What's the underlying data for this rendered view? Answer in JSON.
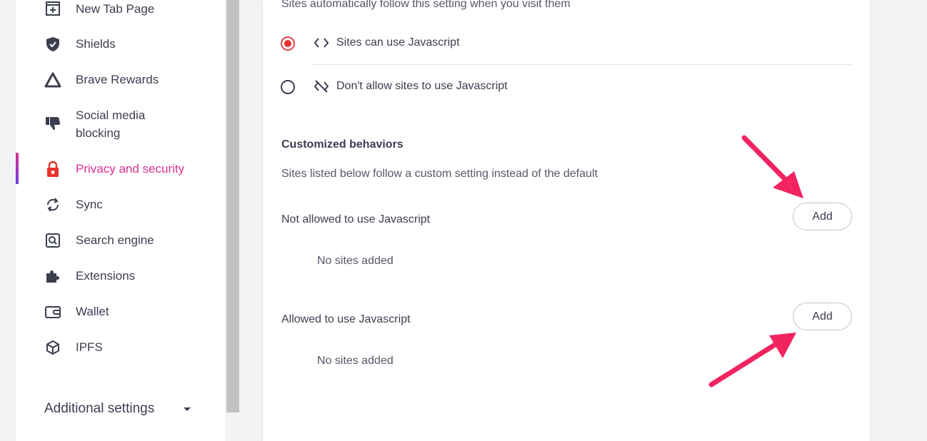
{
  "sidebar": {
    "items": [
      {
        "label": "New Tab Page",
        "icon": "new-tab-icon"
      },
      {
        "label": "Shields",
        "icon": "shield-icon"
      },
      {
        "label": "Brave Rewards",
        "icon": "rewards-triangle-icon"
      },
      {
        "label": "Social media",
        "label2": "blocking",
        "icon": "thumbs-down-icon"
      },
      {
        "label": "Privacy and security",
        "icon": "lock-icon",
        "active": true
      },
      {
        "label": "Sync",
        "icon": "sync-icon"
      },
      {
        "label": "Search engine",
        "icon": "search-engine-icon"
      },
      {
        "label": "Extensions",
        "icon": "puzzle-icon"
      },
      {
        "label": "Wallet",
        "icon": "wallet-icon"
      },
      {
        "label": "IPFS",
        "icon": "cube-icon"
      }
    ],
    "additional_settings": "Additional settings"
  },
  "main": {
    "default_description": "Sites automatically follow this setting when you visit them",
    "options": [
      {
        "label": "Sites can use Javascript",
        "selected": true
      },
      {
        "label": "Don't allow sites to use Javascript",
        "selected": false
      }
    ],
    "customized": {
      "heading": "Customized behaviors",
      "description": "Sites listed below follow a custom setting instead of the default"
    },
    "not_allowed": {
      "label": "Not allowed to use Javascript",
      "button": "Add",
      "empty": "No sites added"
    },
    "allowed": {
      "label": "Allowed to use Javascript",
      "button": "Add",
      "empty": "No sites added"
    }
  },
  "colors": {
    "accent": "#d9318f",
    "radio": "#e8322f",
    "arrow": "#f2245f"
  }
}
